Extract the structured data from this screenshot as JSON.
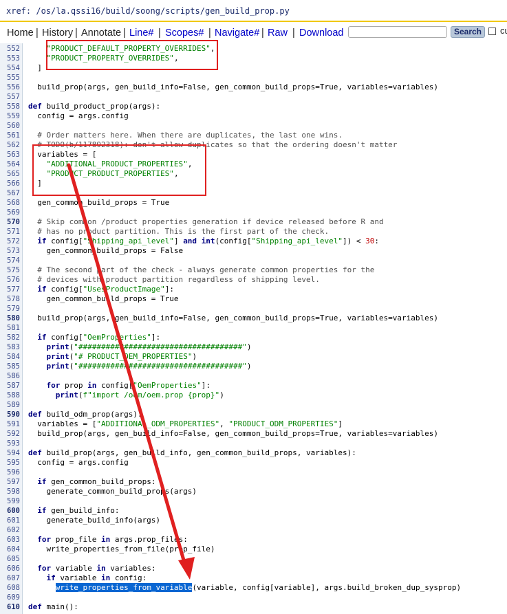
{
  "title": "xref: /os/la.qssi16/build/soong/scripts/gen_build_prop.py",
  "nav": {
    "home": "Home",
    "history": "History",
    "annotate": "Annotate",
    "line": "Line#",
    "scopes": "Scopes#",
    "navigate": "Navigate#",
    "raw": "Raw",
    "download": "Download",
    "search_value": "",
    "search_button": "Search",
    "checkbox_label": "cu"
  },
  "code": {
    "lines": [
      {
        "num": "552",
        "text": "    \"PRODUCT_DEFAULT_PROPERTY_OVERRIDES\","
      },
      {
        "num": "553",
        "text": "    \"PRODUCT_PROPERTY_OVERRIDES\","
      },
      {
        "num": "554",
        "text": "  ]"
      },
      {
        "num": "555",
        "text": ""
      },
      {
        "num": "556",
        "text": "  build_prop(args, gen_build_info=False, gen_common_build_props=True, variables=variables)"
      },
      {
        "num": "557",
        "text": ""
      },
      {
        "num": "558",
        "text": "def build_product_prop(args):"
      },
      {
        "num": "559",
        "text": "  config = args.config"
      },
      {
        "num": "560",
        "text": ""
      },
      {
        "num": "561",
        "text": "  # Order matters here. When there are duplicates, the last one wins."
      },
      {
        "num": "562",
        "text": "  # TODO(b/117892318): don't allow duplicates so that the ordering doesn't matter"
      },
      {
        "num": "563",
        "text": "  variables = ["
      },
      {
        "num": "564",
        "text": "    \"ADDITIONAL_PRODUCT_PROPERTIES\","
      },
      {
        "num": "565",
        "text": "    \"PRODUCT_PRODUCT_PROPERTIES\","
      },
      {
        "num": "566",
        "text": "  ]"
      },
      {
        "num": "567",
        "text": ""
      },
      {
        "num": "568",
        "text": "  gen_common_build_props = True"
      },
      {
        "num": "569",
        "text": ""
      },
      {
        "num": "570",
        "text": "  # Skip common /product properties generation if device released before R and"
      },
      {
        "num": "571",
        "text": "  # has no product partition. This is the first part of the check."
      },
      {
        "num": "572",
        "text": "  if config[\"Shipping_api_level\"] and int(config[\"Shipping_api_level\"]) < 30:"
      },
      {
        "num": "573",
        "text": "    gen_common_build_props = False"
      },
      {
        "num": "574",
        "text": ""
      },
      {
        "num": "575",
        "text": "  # The second part of the check - always generate common properties for the"
      },
      {
        "num": "576",
        "text": "  # devices with product partition regardless of shipping level."
      },
      {
        "num": "577",
        "text": "  if config[\"UsesProductImage\"]:"
      },
      {
        "num": "578",
        "text": "    gen_common_build_props = True"
      },
      {
        "num": "579",
        "text": ""
      },
      {
        "num": "580",
        "text": "  build_prop(args, gen_build_info=False, gen_common_build_props=True, variables=variables)"
      },
      {
        "num": "581",
        "text": ""
      },
      {
        "num": "582",
        "text": "  if config[\"OemProperties\"]:"
      },
      {
        "num": "583",
        "text": "    print(\"####################################\")"
      },
      {
        "num": "584",
        "text": "    print(\"# PRODUCT_OEM_PROPERTIES\")"
      },
      {
        "num": "585",
        "text": "    print(\"####################################\")"
      },
      {
        "num": "586",
        "text": ""
      },
      {
        "num": "587",
        "text": "    for prop in config[\"OemProperties\"]:"
      },
      {
        "num": "588",
        "text": "      print(f\"import /oem/oem.prop {prop}\")"
      },
      {
        "num": "589",
        "text": ""
      },
      {
        "num": "590",
        "text": "def build_odm_prop(args):"
      },
      {
        "num": "591",
        "text": "  variables = [\"ADDITIONAL_ODM_PROPERTIES\", \"PRODUCT_ODM_PROPERTIES\"]"
      },
      {
        "num": "592",
        "text": "  build_prop(args, gen_build_info=False, gen_common_build_props=True, variables=variables)"
      },
      {
        "num": "593",
        "text": ""
      },
      {
        "num": "594",
        "text": "def build_prop(args, gen_build_info, gen_common_build_props, variables):"
      },
      {
        "num": "595",
        "text": "  config = args.config"
      },
      {
        "num": "596",
        "text": ""
      },
      {
        "num": "597",
        "text": "  if gen_common_build_props:"
      },
      {
        "num": "598",
        "text": "    generate_common_build_props(args)"
      },
      {
        "num": "599",
        "text": ""
      },
      {
        "num": "600",
        "text": "  if gen_build_info:"
      },
      {
        "num": "601",
        "text": "    generate_build_info(args)"
      },
      {
        "num": "602",
        "text": ""
      },
      {
        "num": "603",
        "text": "  for prop_file in args.prop_files:"
      },
      {
        "num": "604",
        "text": "    write_properties_from_file(prop_file)"
      },
      {
        "num": "605",
        "text": ""
      },
      {
        "num": "606",
        "text": "  for variable in variables:"
      },
      {
        "num": "607",
        "text": "    if variable in config:"
      },
      {
        "num": "608",
        "text": "      write_properties_from_variable(variable, config[variable], args.build_broken_dup_sysprop)"
      },
      {
        "num": "609",
        "text": ""
      },
      {
        "num": "610",
        "text": "def main():"
      }
    ],
    "selected_text": "write_properties_from_variable"
  }
}
